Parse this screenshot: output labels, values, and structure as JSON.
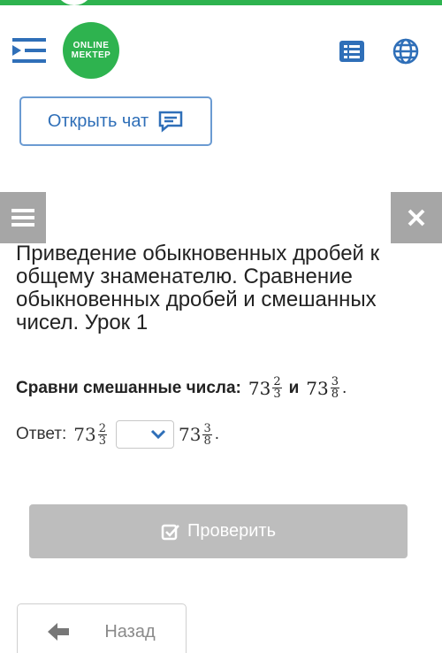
{
  "header": {
    "logo_line1": "ONLINE",
    "logo_line2": "MEKTEP",
    "brand_color": "#2eb34f"
  },
  "chat": {
    "label": "Открыть чат",
    "icon": "chat-icon"
  },
  "lesson": {
    "title": "Приведение обыкновенных дробей к общему знаменателю. Сравнение обыкновенных дробей и смешанных чисел. Урок 1"
  },
  "task": {
    "prompt": "Сравни смешанные числа:",
    "connector": "и",
    "end_mark": ".",
    "first": {
      "whole": "73",
      "num": "2",
      "den": "3"
    },
    "second": {
      "whole": "73",
      "num": "3",
      "den": "8"
    }
  },
  "answer": {
    "label": "Ответ:",
    "select_value": "",
    "end_mark": "."
  },
  "buttons": {
    "check_label": "Проверить",
    "back_label": "Назад"
  }
}
